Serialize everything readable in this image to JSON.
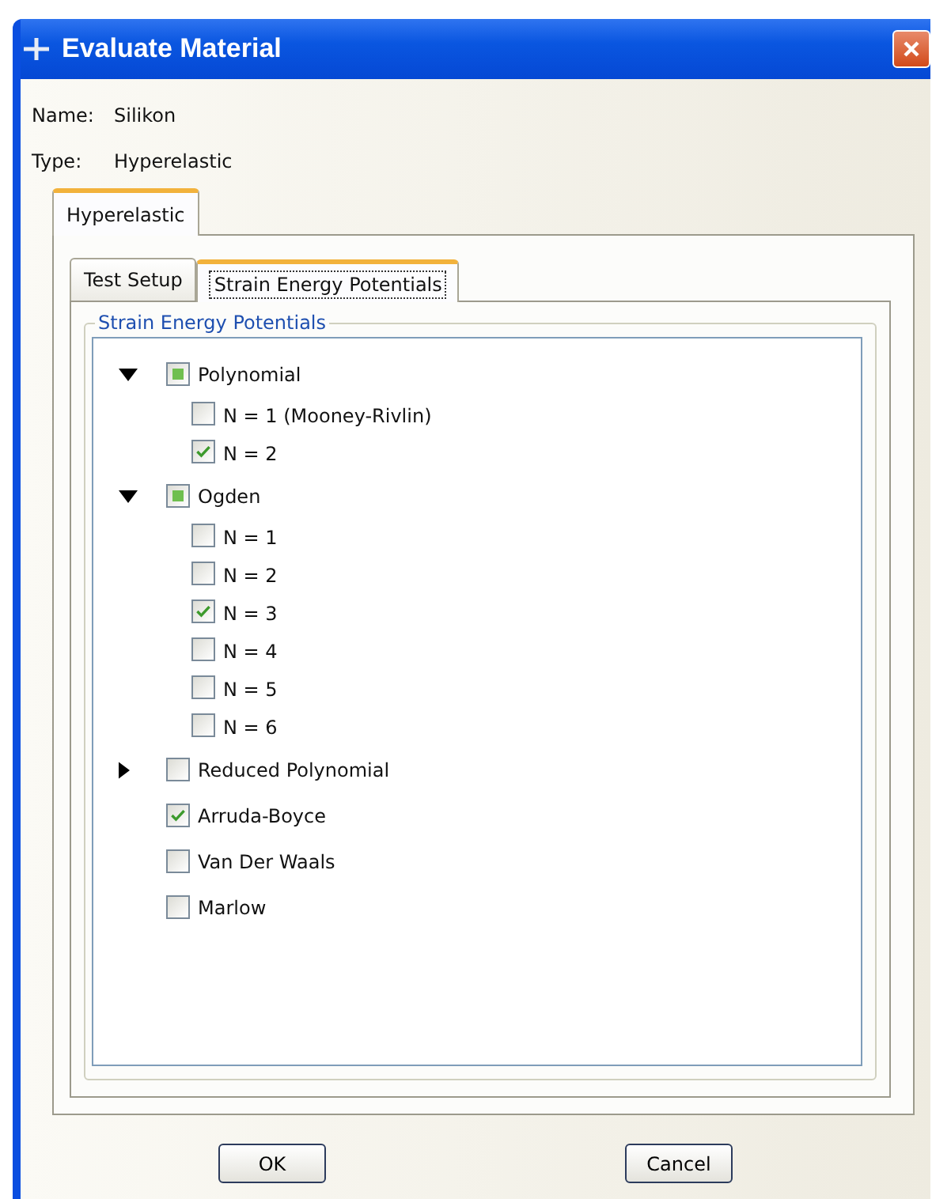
{
  "window": {
    "title": "Evaluate Material"
  },
  "fields": [
    {
      "label": "Name:",
      "value": "Silikon"
    },
    {
      "label": "Type:",
      "value": "Hyperelastic"
    }
  ],
  "outer_tabs": [
    {
      "label": "Hyperelastic",
      "selected": true
    }
  ],
  "inner_tabs": [
    {
      "label": "Test Setup",
      "selected": false
    },
    {
      "label": "Strain Energy Potentials",
      "selected": true
    }
  ],
  "group": {
    "title": "Strain Energy Potentials"
  },
  "tree": [
    {
      "kind": "group",
      "label": "Polynomial",
      "expanded": true,
      "checked": false,
      "mixed": true,
      "children": [
        {
          "label": "N = 1 (Mooney-Rivlin)",
          "checked": false
        },
        {
          "label": "N = 2",
          "checked": true
        }
      ]
    },
    {
      "kind": "group",
      "label": "Ogden",
      "expanded": true,
      "checked": false,
      "mixed": true,
      "children": [
        {
          "label": "N = 1",
          "checked": false
        },
        {
          "label": "N = 2",
          "checked": false
        },
        {
          "label": "N = 3",
          "checked": true
        },
        {
          "label": "N = 4",
          "checked": false
        },
        {
          "label": "N = 5",
          "checked": false
        },
        {
          "label": "N = 6",
          "checked": false
        }
      ]
    },
    {
      "kind": "group",
      "label": "Reduced Polynomial",
      "expanded": false,
      "checked": false,
      "mixed": false
    },
    {
      "kind": "leaf",
      "label": "Arruda-Boyce",
      "checked": true,
      "mixed": false
    },
    {
      "kind": "leaf",
      "label": "Van Der Waals",
      "checked": false,
      "mixed": false
    },
    {
      "kind": "leaf",
      "label": "Marlow",
      "checked": false,
      "mixed": false
    }
  ],
  "buttons": [
    "OK",
    "Cancel"
  ]
}
